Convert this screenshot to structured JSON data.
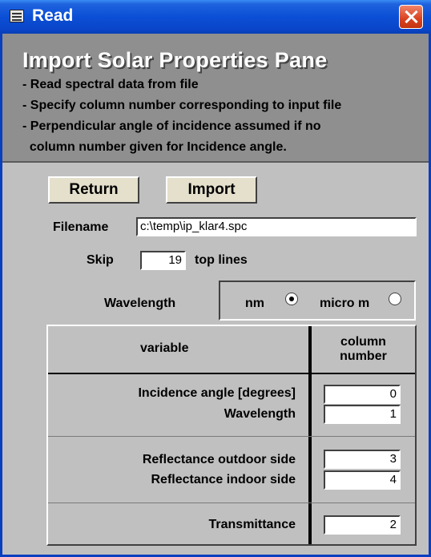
{
  "window": {
    "title": "Read"
  },
  "header": {
    "title": "Import Solar Properties Pane",
    "notes": [
      "- Read spectral data from file",
      "- Specify column number corresponding to input file",
      "- Perpendicular angle of incidence assumed if no",
      "  column number given for Incidence angle."
    ]
  },
  "buttons": {
    "return_label": "Return",
    "import_label": "Import"
  },
  "file": {
    "label": "Filename",
    "value": "c:\\temp\\ip_klar4.spc"
  },
  "skip": {
    "label": "Skip",
    "value": "19",
    "suffix": "top lines"
  },
  "wavelength": {
    "label": "Wavelength",
    "options": [
      {
        "label": "nm",
        "selected": true
      },
      {
        "label": "micro m",
        "selected": false
      }
    ]
  },
  "table": {
    "header_variable": "variable",
    "header_column_line1": "column",
    "header_column_line2": "number",
    "rows": [
      {
        "label": "Incidence angle [degrees]",
        "value": "0"
      },
      {
        "label": "Wavelength",
        "value": "1"
      },
      {
        "label": "Reflectance outdoor side",
        "value": "3"
      },
      {
        "label": "Reflectance indoor side",
        "value": "4"
      },
      {
        "label": "Transmittance",
        "value": "2"
      }
    ]
  }
}
